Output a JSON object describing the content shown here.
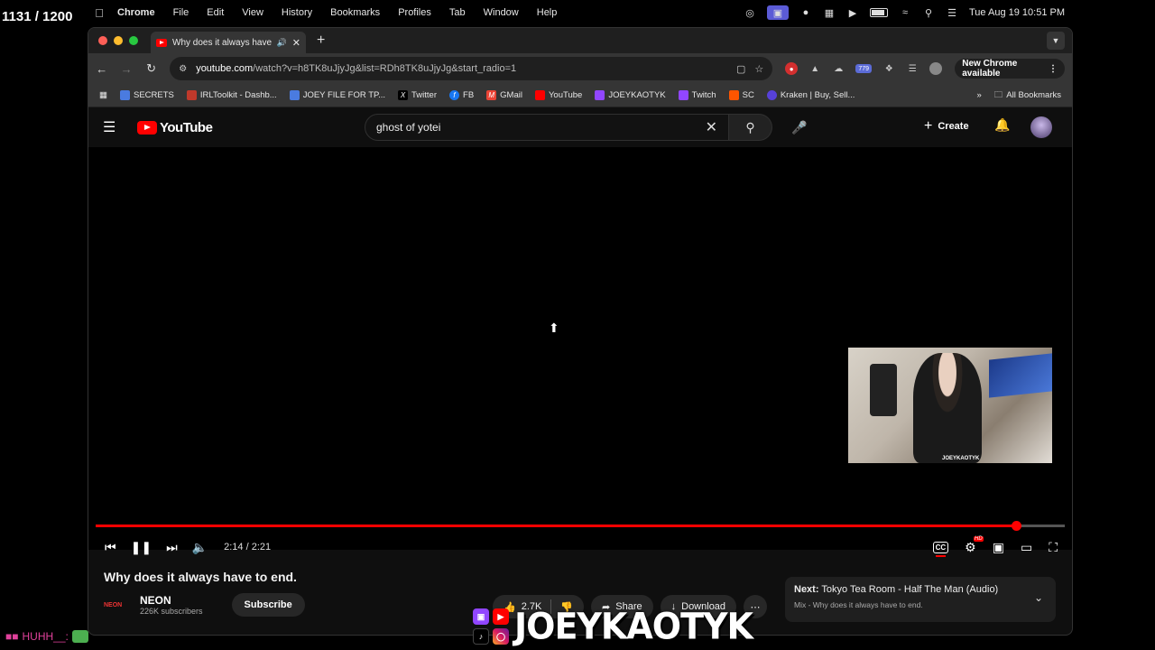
{
  "overlay": {
    "counter": "1131 / 1200",
    "streamer_name": "JOEYKAOTYK",
    "chat_user": "HUHH__:"
  },
  "menubar": {
    "app": "Chrome",
    "items": [
      "File",
      "Edit",
      "View",
      "History",
      "Bookmarks",
      "Profiles",
      "Tab",
      "Window",
      "Help"
    ],
    "clock": "Tue Aug 19  10:51 PM"
  },
  "browser": {
    "tab_title": "Why does it always have t",
    "url_host": "youtube.com",
    "url_path": "/watch?v=h8TK8uJjyJg&list=RDh8TK8uJjyJg&start_radio=1",
    "new_chrome_label": "New Chrome available",
    "ext_badge": "779",
    "bookmarks": [
      {
        "label": "SECRETS",
        "color": "#4a7be0"
      },
      {
        "label": "IRLToolkit - Dashb...",
        "color": "#c0392b"
      },
      {
        "label": "JOEY FILE FOR TP...",
        "color": "#4a7be0"
      },
      {
        "label": "Twitter",
        "color": "#000000"
      },
      {
        "label": "FB",
        "color": "#1877f2"
      },
      {
        "label": "GMail",
        "color": "#ea4335"
      },
      {
        "label": "YouTube",
        "color": "#ff0000"
      },
      {
        "label": "JOEYKAOTYK",
        "color": "#9146ff"
      },
      {
        "label": "Twitch",
        "color": "#9146ff"
      },
      {
        "label": "SC",
        "color": "#ff5500"
      },
      {
        "label": "Kraken | Buy, Sell...",
        "color": "#5741d9"
      }
    ],
    "all_bookmarks": "All Bookmarks"
  },
  "youtube": {
    "logo_text": "YouTube",
    "search_query": "ghost of yotei",
    "create_label": "Create",
    "player": {
      "time": "2:14 / 2:21",
      "progress": 0.95
    },
    "video_title": "Why does it always have to end.",
    "channel_logo_text": "NEON",
    "channel_name": "NEON",
    "channel_subs": "226K subscribers",
    "subscribe_label": "Subscribe",
    "likes": "2.7K",
    "share_label": "Share",
    "download_label": "Download",
    "next_label": "Next:",
    "next_title": "Tokyo Tea Room - Half The Man (Audio)",
    "next_sub": "Mix - Why does it always have to end."
  },
  "facecam": {
    "watermark": "JOEYKAOTYK"
  }
}
